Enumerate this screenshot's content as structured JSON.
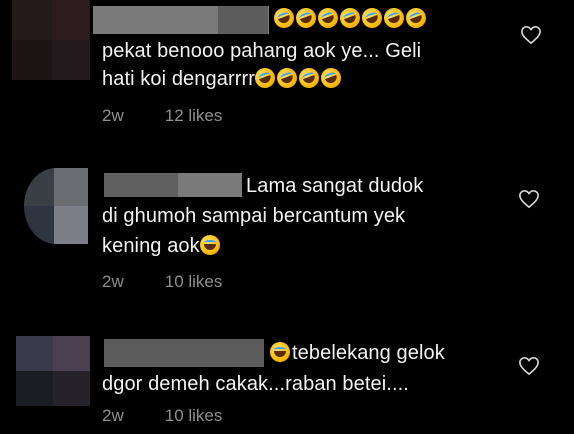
{
  "comments": [
    {
      "text_line1": "pekat benooo pahang aok ye... Geli",
      "text_line2": "hati koi dengarrrr",
      "age": "2w",
      "likes": "12 likes",
      "like_icon": "heart-outline-icon",
      "emoji_top_count": 7,
      "emoji_inline_count": 4
    },
    {
      "text_line1": "Lama sangat dudok",
      "text_line2": "di ghumoh sampai bercantum yek",
      "text_line3": "kening aok",
      "age": "2w",
      "likes": "10 likes",
      "like_icon": "heart-outline-icon"
    },
    {
      "text_line1": "tebelekang gelok",
      "text_line2": "dgor demeh cakak...raban betei....",
      "age": "2w",
      "likes": "10 likes",
      "like_icon": "heart-outline-icon"
    }
  ],
  "colors": {
    "background": "#000000",
    "text": "#f2f2f2",
    "meta": "#8e8e8e",
    "redaction": "#6e6e6e"
  }
}
